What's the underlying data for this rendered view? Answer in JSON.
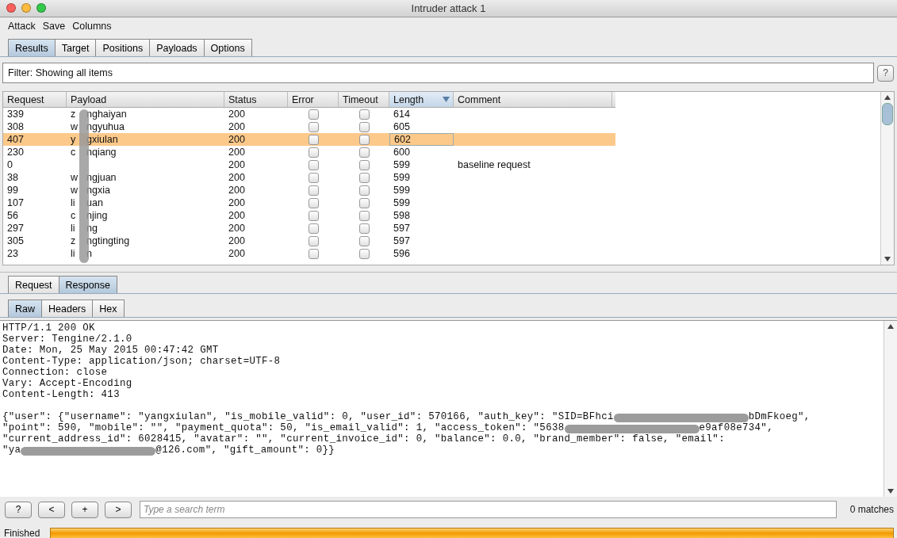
{
  "window": {
    "title": "Intruder attack 1"
  },
  "menu": [
    "Attack",
    "Save",
    "Columns"
  ],
  "tabs": [
    {
      "label": "Results",
      "selected": true
    },
    {
      "label": "Target",
      "selected": false
    },
    {
      "label": "Positions",
      "selected": false
    },
    {
      "label": "Payloads",
      "selected": false
    },
    {
      "label": "Options",
      "selected": false
    }
  ],
  "filter": {
    "text": "Filter: Showing all items",
    "help": "?"
  },
  "table": {
    "columns": [
      {
        "label": "Request",
        "sorted": false
      },
      {
        "label": "Payload",
        "sorted": false
      },
      {
        "label": "Status",
        "sorted": false
      },
      {
        "label": "Error",
        "sorted": false
      },
      {
        "label": "Timeout",
        "sorted": false
      },
      {
        "label": "Length",
        "sorted": true
      },
      {
        "label": "Comment",
        "sorted": false
      }
    ],
    "rows": [
      {
        "request": "339",
        "payload_start": "z",
        "payload_end": "nghaiyan",
        "status": "200",
        "error": false,
        "timeout": false,
        "length": "614",
        "comment": "",
        "selected": false
      },
      {
        "request": "308",
        "payload_start": "w",
        "payload_end": "ngyuhua",
        "status": "200",
        "error": false,
        "timeout": false,
        "length": "605",
        "comment": "",
        "selected": false
      },
      {
        "request": "407",
        "payload_start": "y",
        "payload_end": "gxiulan",
        "status": "200",
        "error": false,
        "timeout": false,
        "length": "602",
        "comment": "",
        "selected": true
      },
      {
        "request": "230",
        "payload_start": "c",
        "payload_end": "nqiang",
        "status": "200",
        "error": false,
        "timeout": false,
        "length": "600",
        "comment": "",
        "selected": false
      },
      {
        "request": "0",
        "payload_start": "",
        "payload_end": "",
        "status": "200",
        "error": false,
        "timeout": false,
        "length": "599",
        "comment": "baseline request",
        "selected": false
      },
      {
        "request": "38",
        "payload_start": "w",
        "payload_end": "ngjuan",
        "status": "200",
        "error": false,
        "timeout": false,
        "length": "599",
        "comment": "",
        "selected": false
      },
      {
        "request": "99",
        "payload_start": "w",
        "payload_end": "ngxia",
        "status": "200",
        "error": false,
        "timeout": false,
        "length": "599",
        "comment": "",
        "selected": false
      },
      {
        "request": "107",
        "payload_start": "li",
        "payload_end": "uan",
        "status": "200",
        "error": false,
        "timeout": false,
        "length": "599",
        "comment": "",
        "selected": false
      },
      {
        "request": "56",
        "payload_start": "c",
        "payload_end": "njing",
        "status": "200",
        "error": false,
        "timeout": false,
        "length": "598",
        "comment": "",
        "selected": false
      },
      {
        "request": "297",
        "payload_start": "li",
        "payload_end": "ng",
        "status": "200",
        "error": false,
        "timeout": false,
        "length": "597",
        "comment": "",
        "selected": false
      },
      {
        "request": "305",
        "payload_start": "z",
        "payload_end": "ngtingting",
        "status": "200",
        "error": false,
        "timeout": false,
        "length": "597",
        "comment": "",
        "selected": false
      },
      {
        "request": "23",
        "payload_start": "li",
        "payload_end": "n",
        "status": "200",
        "error": false,
        "timeout": false,
        "length": "596",
        "comment": "",
        "selected": false
      }
    ]
  },
  "message_tabs": [
    {
      "label": "Request",
      "selected": false
    },
    {
      "label": "Response",
      "selected": true
    }
  ],
  "view_tabs": [
    {
      "label": "Raw",
      "selected": true
    },
    {
      "label": "Headers",
      "selected": false
    },
    {
      "label": "Hex",
      "selected": false
    }
  ],
  "response_lines": [
    [
      {
        "kind": "text",
        "text": "HTTP/1.1 200 OK"
      }
    ],
    [
      {
        "kind": "text",
        "text": "Server: Tengine/2.1.0"
      }
    ],
    [
      {
        "kind": "text",
        "text": "Date: Mon, 25 May 2015 00:47:42 GMT"
      }
    ],
    [
      {
        "kind": "text",
        "text": "Content-Type: application/json; charset=UTF-8"
      }
    ],
    [
      {
        "kind": "text",
        "text": "Connection: close"
      }
    ],
    [
      {
        "kind": "text",
        "text": "Vary: Accept-Encoding"
      }
    ],
    [
      {
        "kind": "text",
        "text": "Content-Length: 413"
      }
    ],
    [
      {
        "kind": "blank"
      },
      {
        "kind": "text",
        "text": "{\"user\": {\"username\": \"yangxiulan\", \"is_mobile_valid\": 0, \"user_id\": 570166, \"auth_key\": \"SID=BFhci"
      },
      {
        "kind": "redacted"
      },
      {
        "kind": "text",
        "text": "bDmFkoeg\","
      }
    ],
    [
      {
        "kind": "text",
        "text": "\"point\": 590, \"mobile\": \"\", \"payment_quota\": 50, \"is_email_valid\": 1, \"access_token\": \"5638"
      },
      {
        "kind": "redacted"
      },
      {
        "kind": "text",
        "text": "e9af08e734\","
      }
    ],
    [
      {
        "kind": "text",
        "text": "\"current_address_id\": 6028415, \"avatar\": \"\", \"current_invoice_id\": 0, \"balance\": 0.0, \"brand_member\": false, \"email\":"
      }
    ],
    [
      {
        "kind": "text",
        "text": "\"ya"
      },
      {
        "kind": "redacted"
      },
      {
        "kind": "text",
        "text": "@126.com\", \"gift_amount\": 0}}"
      }
    ]
  ],
  "search": {
    "buttons": [
      "?",
      "<",
      "+",
      ">"
    ],
    "placeholder": "Type a search term",
    "matches": "0 matches"
  },
  "status_bar": {
    "text": "Finished",
    "level": 1
  }
}
